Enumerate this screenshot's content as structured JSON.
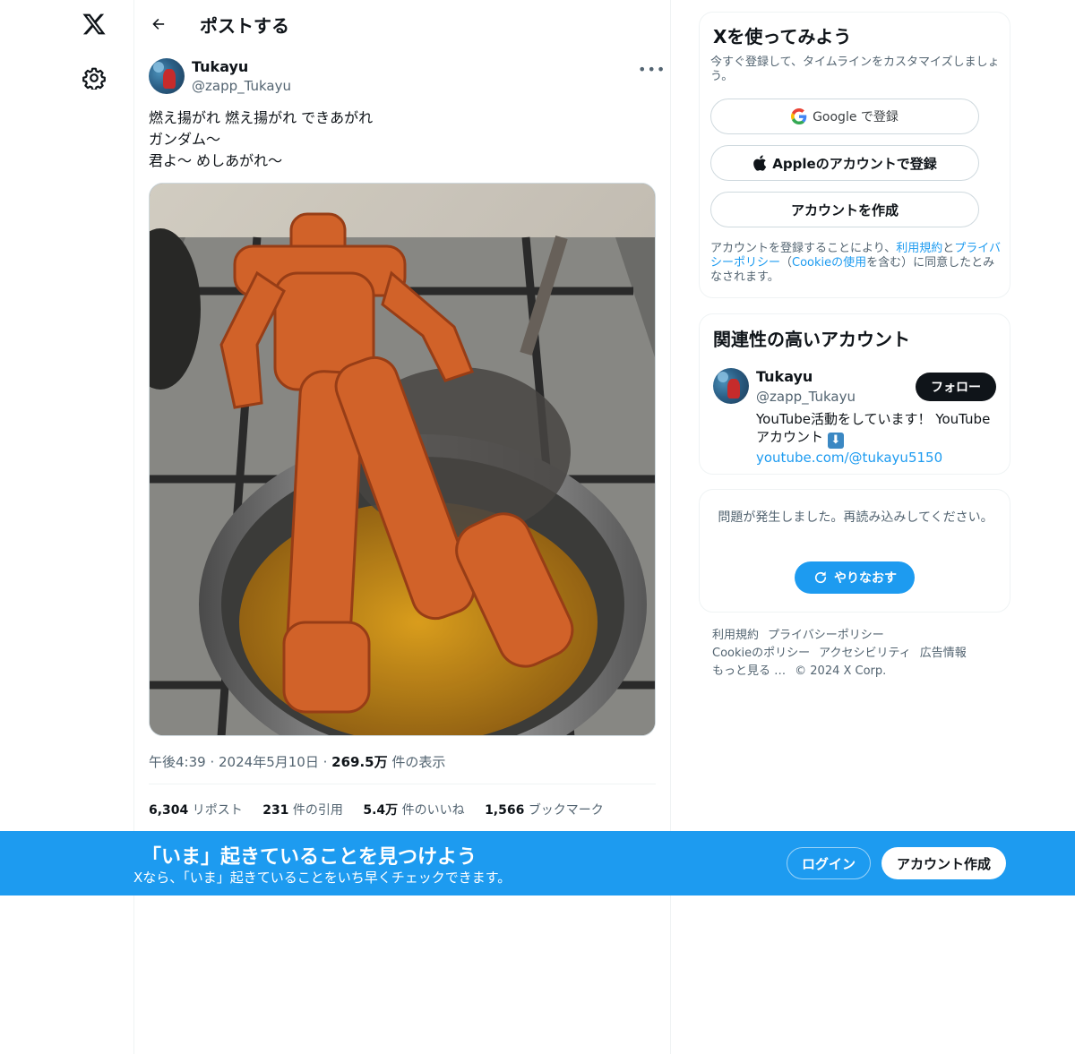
{
  "nav": {
    "logo_icon": "x-logo-icon",
    "settings_icon": "gear-icon"
  },
  "header": {
    "back_icon": "arrow-left-icon",
    "title": "ポストする"
  },
  "post": {
    "author_name": "Tukayu",
    "author_handle": "@zapp_Tukayu",
    "more_icon": "more-horizontal-icon",
    "text_lines": [
      "燃え揚がれ 燃え揚がれ できあがれ",
      "ガンダム〜",
      "君よ〜 めしあがれ〜"
    ],
    "time": "午後4:39",
    "date": "2024年5月10日",
    "views_value": "269.5万",
    "views_label": "件の表示",
    "stats": [
      {
        "value": "6,304",
        "label": "リポスト"
      },
      {
        "value": "231",
        "label": "件の引用"
      },
      {
        "value": "5.4万",
        "label": "件のいいね"
      },
      {
        "value": "1,566",
        "label": "ブックマーク"
      }
    ]
  },
  "signup_card": {
    "title": "Xを使ってみよう",
    "subtitle": "今すぐ登録して、タイムラインをカスタマイズしましょう。",
    "google_label": "Google で登録",
    "apple_label": "Appleのアカウントで登録",
    "create_label": "アカウントを作成",
    "legal_prefix": "アカウントを登録することにより、",
    "legal_terms": "利用規約",
    "legal_and": "と",
    "legal_privacy": "プライバシーポリシー",
    "legal_mid": "（",
    "legal_cookie": "Cookieの使用",
    "legal_suffix": "を含む）に同意したとみなされます。"
  },
  "relevant_card": {
    "title": "関連性の高いアカウント",
    "name": "Tukayu",
    "handle": "@zapp_Tukayu",
    "follow_label": "フォロー",
    "bio_text": "YouTube活動をしています！ YouTubeアカウント",
    "bio_emoji": "⬇",
    "bio_link": "youtube.com/@tukayu5150"
  },
  "error_card": {
    "message": "問題が発生しました。再読み込みしてください。",
    "retry_label": "やりなおす"
  },
  "footer": {
    "links": [
      "利用規約",
      "プライバシーポリシー",
      "Cookieのポリシー",
      "アクセシビリティ",
      "広告情報",
      "もっと見る …",
      "© 2024 X Corp."
    ]
  },
  "banner": {
    "title": "「いま」起きていることを見つけよう",
    "subtitle": "Xなら、「いま」起きていることをいち早くチェックできます。",
    "login_label": "ログイン",
    "signup_label": "アカウント作成"
  },
  "colors": {
    "accent": "#1d9bf0",
    "text_primary": "#0f1419",
    "text_secondary": "#536471"
  }
}
